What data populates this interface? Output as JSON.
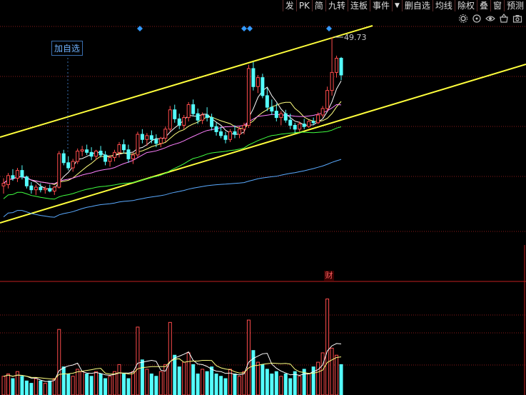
{
  "toolbar": {
    "items": [
      "发",
      "PK",
      "简",
      "九转",
      "连板",
      "事件",
      "删自选",
      "均线",
      "除权",
      "叠",
      "窗",
      "预测"
    ],
    "dropdown_icon": "caret-down-icon"
  },
  "icons": [
    "settings-icon",
    "target-icon",
    "eye-icon",
    "basket-icon",
    "camera-icon"
  ],
  "add_favorite_label": "加自选",
  "high_price_label": "49.73",
  "financial_badge": "财",
  "colors": {
    "up": "#ff4c4c",
    "down": "#54fcfc",
    "channel": "#ffff3c",
    "ma5": "#ffffff",
    "ma10": "#ffff80",
    "ma20": "#ff80ff",
    "ma30": "#40ff40",
    "ma60": "#5aaaff",
    "grid": "#8a1a1a",
    "marker": "#3399ff"
  },
  "chart_data": {
    "type": "candlestick",
    "high_label": "49.73",
    "candles": [
      {
        "o": 38.2,
        "h": 38.8,
        "l": 37.6,
        "c": 38.4
      },
      {
        "o": 38.3,
        "h": 39.2,
        "l": 38.0,
        "c": 39.0
      },
      {
        "o": 39.0,
        "h": 39.5,
        "l": 38.6,
        "c": 38.8
      },
      {
        "o": 38.8,
        "h": 39.6,
        "l": 38.5,
        "c": 39.4
      },
      {
        "o": 39.4,
        "h": 39.8,
        "l": 38.7,
        "c": 38.9
      },
      {
        "o": 38.9,
        "h": 39.0,
        "l": 38.0,
        "c": 38.2
      },
      {
        "o": 38.2,
        "h": 38.5,
        "l": 37.6,
        "c": 37.9
      },
      {
        "o": 37.9,
        "h": 38.3,
        "l": 37.5,
        "c": 38.1
      },
      {
        "o": 38.1,
        "h": 38.4,
        "l": 37.7,
        "c": 37.9
      },
      {
        "o": 37.9,
        "h": 38.2,
        "l": 37.6,
        "c": 38.0
      },
      {
        "o": 38.0,
        "h": 38.3,
        "l": 37.7,
        "c": 37.8
      },
      {
        "o": 37.8,
        "h": 38.2,
        "l": 37.5,
        "c": 38.1
      },
      {
        "o": 38.1,
        "h": 40.9,
        "l": 38.0,
        "c": 40.7
      },
      {
        "o": 40.7,
        "h": 41.0,
        "l": 39.8,
        "c": 40.0
      },
      {
        "o": 40.0,
        "h": 40.5,
        "l": 39.4,
        "c": 39.6
      },
      {
        "o": 39.6,
        "h": 40.3,
        "l": 39.3,
        "c": 40.1
      },
      {
        "o": 40.1,
        "h": 41.1,
        "l": 39.9,
        "c": 40.9
      },
      {
        "o": 40.9,
        "h": 41.3,
        "l": 40.5,
        "c": 41.0
      },
      {
        "o": 41.0,
        "h": 41.4,
        "l": 40.6,
        "c": 40.8
      },
      {
        "o": 40.8,
        "h": 41.2,
        "l": 40.2,
        "c": 40.5
      },
      {
        "o": 40.5,
        "h": 41.0,
        "l": 40.2,
        "c": 40.9
      },
      {
        "o": 40.9,
        "h": 41.3,
        "l": 40.4,
        "c": 40.6
      },
      {
        "o": 40.6,
        "h": 40.9,
        "l": 39.8,
        "c": 40.1
      },
      {
        "o": 40.1,
        "h": 40.6,
        "l": 39.7,
        "c": 40.4
      },
      {
        "o": 40.4,
        "h": 41.0,
        "l": 40.1,
        "c": 40.8
      },
      {
        "o": 40.8,
        "h": 41.6,
        "l": 40.4,
        "c": 41.4
      },
      {
        "o": 41.4,
        "h": 41.8,
        "l": 40.7,
        "c": 41.0
      },
      {
        "o": 41.0,
        "h": 41.4,
        "l": 40.0,
        "c": 40.3
      },
      {
        "o": 40.3,
        "h": 40.8,
        "l": 39.9,
        "c": 40.6
      },
      {
        "o": 40.6,
        "h": 42.4,
        "l": 40.4,
        "c": 42.2
      },
      {
        "o": 42.2,
        "h": 42.6,
        "l": 41.5,
        "c": 41.8
      },
      {
        "o": 41.8,
        "h": 42.3,
        "l": 41.3,
        "c": 42.1
      },
      {
        "o": 42.1,
        "h": 42.5,
        "l": 41.5,
        "c": 41.8
      },
      {
        "o": 41.8,
        "h": 42.2,
        "l": 41.2,
        "c": 41.5
      },
      {
        "o": 41.5,
        "h": 42.0,
        "l": 41.2,
        "c": 41.9
      },
      {
        "o": 41.9,
        "h": 42.8,
        "l": 41.6,
        "c": 42.6
      },
      {
        "o": 42.6,
        "h": 44.4,
        "l": 42.4,
        "c": 44.1
      },
      {
        "o": 44.1,
        "h": 44.5,
        "l": 43.1,
        "c": 43.4
      },
      {
        "o": 43.4,
        "h": 43.8,
        "l": 42.6,
        "c": 42.9
      },
      {
        "o": 42.9,
        "h": 43.7,
        "l": 42.6,
        "c": 43.5
      },
      {
        "o": 43.5,
        "h": 44.7,
        "l": 43.2,
        "c": 44.5
      },
      {
        "o": 44.5,
        "h": 44.9,
        "l": 43.6,
        "c": 43.8
      },
      {
        "o": 43.8,
        "h": 44.2,
        "l": 43.0,
        "c": 43.3
      },
      {
        "o": 43.3,
        "h": 43.9,
        "l": 43.0,
        "c": 43.7
      },
      {
        "o": 43.7,
        "h": 44.3,
        "l": 43.2,
        "c": 43.5
      },
      {
        "o": 43.5,
        "h": 43.8,
        "l": 42.5,
        "c": 42.8
      },
      {
        "o": 42.8,
        "h": 43.1,
        "l": 42.1,
        "c": 42.4
      },
      {
        "o": 42.4,
        "h": 42.8,
        "l": 41.9,
        "c": 42.1
      },
      {
        "o": 42.1,
        "h": 42.4,
        "l": 41.5,
        "c": 41.8
      },
      {
        "o": 41.8,
        "h": 42.6,
        "l": 41.6,
        "c": 42.4
      },
      {
        "o": 42.4,
        "h": 42.9,
        "l": 41.9,
        "c": 42.2
      },
      {
        "o": 42.2,
        "h": 42.8,
        "l": 41.9,
        "c": 42.6
      },
      {
        "o": 42.6,
        "h": 43.1,
        "l": 42.2,
        "c": 42.9
      },
      {
        "o": 42.9,
        "h": 47.6,
        "l": 42.7,
        "c": 47.3
      },
      {
        "o": 47.3,
        "h": 47.8,
        "l": 45.6,
        "c": 45.9
      },
      {
        "o": 45.9,
        "h": 46.8,
        "l": 45.4,
        "c": 46.6
      },
      {
        "o": 46.6,
        "h": 46.9,
        "l": 45.0,
        "c": 45.2
      },
      {
        "o": 45.2,
        "h": 45.8,
        "l": 44.0,
        "c": 44.3
      },
      {
        "o": 44.3,
        "h": 44.9,
        "l": 43.7,
        "c": 44.0
      },
      {
        "o": 44.0,
        "h": 44.6,
        "l": 43.2,
        "c": 43.5
      },
      {
        "o": 43.5,
        "h": 44.0,
        "l": 42.9,
        "c": 43.8
      },
      {
        "o": 43.8,
        "h": 44.1,
        "l": 43.1,
        "c": 43.3
      },
      {
        "o": 43.3,
        "h": 43.8,
        "l": 42.6,
        "c": 42.9
      },
      {
        "o": 42.9,
        "h": 43.1,
        "l": 42.3,
        "c": 42.6
      },
      {
        "o": 42.6,
        "h": 43.2,
        "l": 42.4,
        "c": 43.0
      },
      {
        "o": 43.0,
        "h": 43.4,
        "l": 42.6,
        "c": 42.8
      },
      {
        "o": 42.8,
        "h": 43.3,
        "l": 42.7,
        "c": 43.2
      },
      {
        "o": 43.2,
        "h": 43.5,
        "l": 42.9,
        "c": 43.1
      },
      {
        "o": 43.1,
        "h": 43.9,
        "l": 43.0,
        "c": 43.7
      },
      {
        "o": 43.7,
        "h": 44.4,
        "l": 43.5,
        "c": 44.2
      },
      {
        "o": 44.2,
        "h": 45.9,
        "l": 44.0,
        "c": 45.6
      },
      {
        "o": 45.6,
        "h": 49.73,
        "l": 45.2,
        "c": 47.0
      },
      {
        "o": 47.0,
        "h": 48.3,
        "l": 46.6,
        "c": 48.1
      },
      {
        "o": 48.1,
        "h": 48.2,
        "l": 46.4,
        "c": 46.8
      }
    ],
    "volume": [
      8,
      9,
      7,
      10,
      8,
      6,
      5,
      7,
      6,
      5,
      6,
      7,
      28,
      12,
      9,
      8,
      11,
      10,
      9,
      8,
      10,
      9,
      7,
      8,
      10,
      13,
      9,
      7,
      10,
      29,
      15,
      11,
      9,
      8,
      10,
      13,
      31,
      17,
      12,
      14,
      18,
      13,
      9,
      11,
      10,
      12,
      9,
      8,
      7,
      11,
      9,
      8,
      10,
      32,
      19,
      14,
      13,
      11,
      9,
      10,
      8,
      9,
      7,
      10,
      8,
      11,
      9,
      12,
      14,
      18,
      41,
      20,
      17,
      13
    ]
  }
}
